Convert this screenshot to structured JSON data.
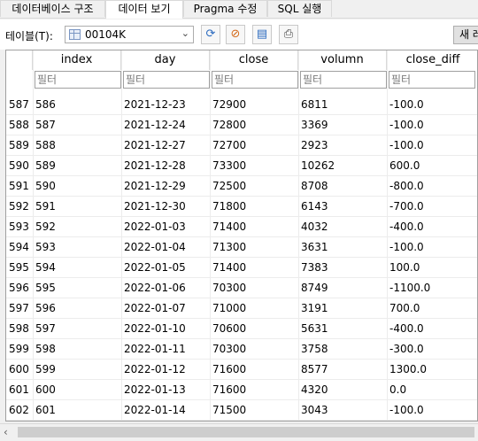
{
  "tabs": [
    {
      "label": "데이터베이스 구조"
    },
    {
      "label": "데이터 보기"
    },
    {
      "label": "Pragma 수정"
    },
    {
      "label": "SQL 실행"
    }
  ],
  "toolbar": {
    "table_label": "테이블(T):",
    "table_value": "00104K",
    "new_label": "새 레"
  },
  "grid": {
    "columns": [
      "index",
      "day",
      "close",
      "volumn",
      "close_diff"
    ],
    "filter_placeholder": "필터",
    "rows": [
      {
        "rownum": "587",
        "index": "586",
        "day": "2021-12-23",
        "close": "72900",
        "volumn": "6811",
        "close_diff": "-100.0"
      },
      {
        "rownum": "588",
        "index": "587",
        "day": "2021-12-24",
        "close": "72800",
        "volumn": "3369",
        "close_diff": "-100.0"
      },
      {
        "rownum": "589",
        "index": "588",
        "day": "2021-12-27",
        "close": "72700",
        "volumn": "2923",
        "close_diff": "-100.0"
      },
      {
        "rownum": "590",
        "index": "589",
        "day": "2021-12-28",
        "close": "73300",
        "volumn": "10262",
        "close_diff": "600.0"
      },
      {
        "rownum": "591",
        "index": "590",
        "day": "2021-12-29",
        "close": "72500",
        "volumn": "8708",
        "close_diff": "-800.0"
      },
      {
        "rownum": "592",
        "index": "591",
        "day": "2021-12-30",
        "close": "71800",
        "volumn": "6143",
        "close_diff": "-700.0"
      },
      {
        "rownum": "593",
        "index": "592",
        "day": "2022-01-03",
        "close": "71400",
        "volumn": "4032",
        "close_diff": "-400.0"
      },
      {
        "rownum": "594",
        "index": "593",
        "day": "2022-01-04",
        "close": "71300",
        "volumn": "3631",
        "close_diff": "-100.0"
      },
      {
        "rownum": "595",
        "index": "594",
        "day": "2022-01-05",
        "close": "71400",
        "volumn": "7383",
        "close_diff": "100.0"
      },
      {
        "rownum": "596",
        "index": "595",
        "day": "2022-01-06",
        "close": "70300",
        "volumn": "8749",
        "close_diff": "-1100.0"
      },
      {
        "rownum": "597",
        "index": "596",
        "day": "2022-01-07",
        "close": "71000",
        "volumn": "3191",
        "close_diff": "700.0"
      },
      {
        "rownum": "598",
        "index": "597",
        "day": "2022-01-10",
        "close": "70600",
        "volumn": "5631",
        "close_diff": "-400.0"
      },
      {
        "rownum": "599",
        "index": "598",
        "day": "2022-01-11",
        "close": "70300",
        "volumn": "3758",
        "close_diff": "-300.0"
      },
      {
        "rownum": "600",
        "index": "599",
        "day": "2022-01-12",
        "close": "71600",
        "volumn": "8577",
        "close_diff": "1300.0"
      },
      {
        "rownum": "601",
        "index": "600",
        "day": "2022-01-13",
        "close": "71600",
        "volumn": "4320",
        "close_diff": "0.0"
      },
      {
        "rownum": "602",
        "index": "601",
        "day": "2022-01-14",
        "close": "71500",
        "volumn": "3043",
        "close_diff": "-100.0"
      }
    ]
  }
}
